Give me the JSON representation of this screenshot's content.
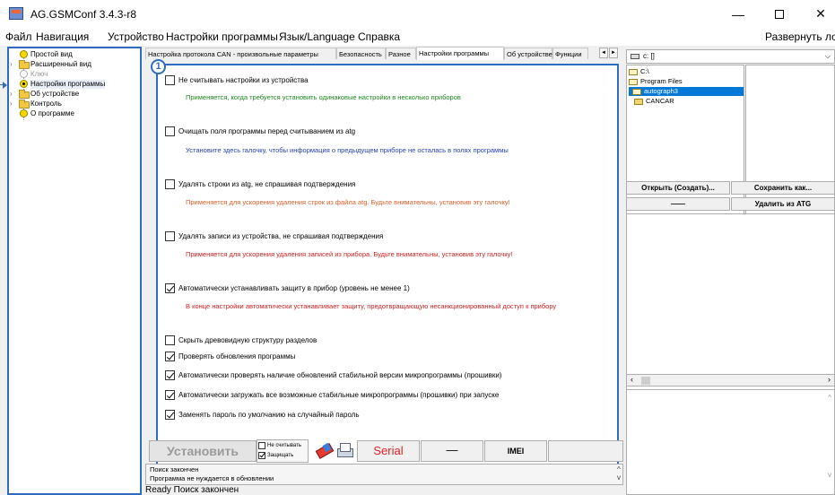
{
  "window": {
    "title": "AG.GSMConf 3.4.3-r8",
    "minimize": "—",
    "close": "✕"
  },
  "menu": {
    "items": [
      "Файл",
      "Навигация",
      "Устройство",
      "Настройки программы",
      "Язык/Language",
      "Справка"
    ],
    "right": "Развернуть лог"
  },
  "tree": {
    "items": [
      {
        "label": "Простой вид"
      },
      {
        "label": "Расширенный вид"
      },
      {
        "label": "Ключ"
      },
      {
        "label": "Настройки программы"
      },
      {
        "label": "Об устройстве"
      },
      {
        "label": "Контроль"
      },
      {
        "label": "О программе"
      }
    ]
  },
  "tabs": {
    "items": [
      "Настройка протокола CAN - произвольные параметры",
      "Безопасность",
      "Разное",
      "Настройки программы",
      "Об устройстве",
      "Функции"
    ],
    "active_index": 3,
    "scroll_left": "◄",
    "scroll_right": "►"
  },
  "settings": {
    "badge": "1",
    "options": [
      {
        "label": "Не считывать настройки из устройства",
        "checked": false,
        "desc": "Применяется, когда требуется установить одинаковые настройки в несколько приборов",
        "color": "#1f8a1f"
      },
      {
        "label": "Очищать поля программы перед считыванием из atg",
        "checked": false,
        "desc": "Установите здесь галочку, чтобы информация о предыдущем приборе не осталась в полях программы",
        "color": "#2741b8"
      },
      {
        "label": "Удалять строки из atg, не спрашивая подтверждения",
        "checked": false,
        "desc": "Применяется для ускорения удаления строк из файла atg. Будьте внимательны, установив эту галочку!",
        "color": "#e0602a"
      },
      {
        "label": "Удалять записи из устройства, не спрашивая подтверждения",
        "checked": false,
        "desc": "Применяется для ускорения удаления записей из прибора. Будьте внимательны, установив эту галочку!",
        "color": "#d62222"
      },
      {
        "label": "Автоматически устанавливать защиту в прибор (уровень не менее 1)",
        "checked": true,
        "desc": "В конце настройки автоматически устанавливает защиту, предотвращающую несанкционированный доступ к прибору",
        "color": "#d62222"
      }
    ],
    "extra": [
      {
        "label": "Скрыть древовидную структуру разделов",
        "checked": false
      },
      {
        "label": "Проверять обновления программы",
        "checked": true
      },
      {
        "label": "Автоматически проверять наличие обновлений стабильной версии микропрограммы (прошивки)",
        "checked": true
      },
      {
        "label": "Автоматически загружать все возможные стабильные микропрограммы (прошивки) при запуске",
        "checked": true
      },
      {
        "label": "Заменять пароль по умолчанию на случайный пароль",
        "checked": true
      }
    ]
  },
  "toolbar": {
    "install": "Установить",
    "no_read": "Не считывать",
    "protect": "Защищать",
    "no_read_checked": false,
    "protect_checked": true,
    "serial": "Serial",
    "dash": "—",
    "imei": "IMEI"
  },
  "log": {
    "lines": [
      "Поиск закончен",
      "Программа не нуждается в обновлении"
    ],
    "up": "^",
    "down": "v"
  },
  "status": {
    "text": "Ready  Поиск закончен"
  },
  "right_panel": {
    "drive": "c: []",
    "dirs": [
      {
        "name": "C:\\",
        "selected": false
      },
      {
        "name": "Program Files",
        "selected": false
      },
      {
        "name": "autograph3",
        "selected": true
      },
      {
        "name": "CANCAR",
        "selected": false
      }
    ],
    "open_btn": "Открыть (Создать)...",
    "save_btn": "Сохранить как...",
    "dash_btn": "——",
    "delete_btn": "Удалить из ATG"
  }
}
